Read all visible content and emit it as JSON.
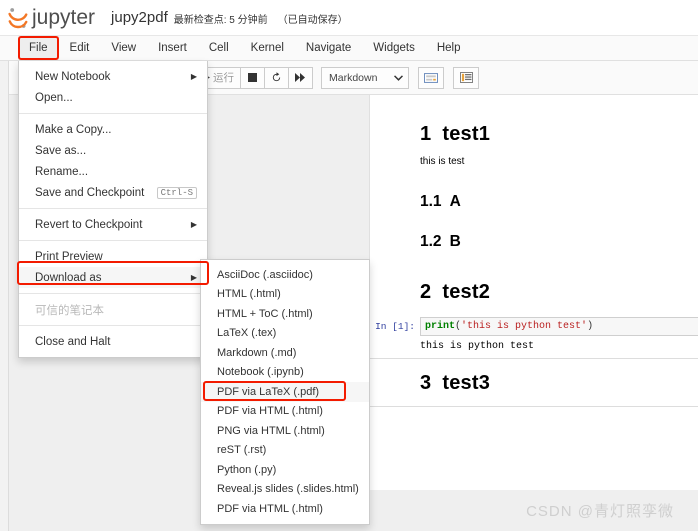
{
  "header": {
    "logo_text": "jupyter",
    "notebook_name": "jupy2pdf",
    "checkpoint_text": "最新检查点: 5 分钟前",
    "autosave_text": "（已自动保存）"
  },
  "menubar": {
    "items": [
      {
        "label": "File",
        "open": true
      },
      {
        "label": "Edit",
        "open": false
      },
      {
        "label": "View",
        "open": false
      },
      {
        "label": "Insert",
        "open": false
      },
      {
        "label": "Cell",
        "open": false
      },
      {
        "label": "Kernel",
        "open": false
      },
      {
        "label": "Navigate",
        "open": false
      },
      {
        "label": "Widgets",
        "open": false
      },
      {
        "label": "Help",
        "open": false
      }
    ]
  },
  "toolbar": {
    "run_label": "运行",
    "cell_type": "Markdown",
    "icons": {
      "run": "play-icon",
      "stop": "stop-icon",
      "restart": "restart-icon",
      "restart_run_all": "fast-forward-icon",
      "dropdown_caret": "chevron-down-icon",
      "command_palette": "keyboard-icon",
      "cell_toolbar": "list-icon"
    }
  },
  "file_menu": {
    "groups": [
      [
        {
          "label": "New Notebook",
          "submenu": true,
          "disabled": false,
          "highlighted": false
        },
        {
          "label": "Open...",
          "submenu": false,
          "disabled": false,
          "highlighted": false
        }
      ],
      [
        {
          "label": "Make a Copy...",
          "submenu": false,
          "disabled": false,
          "highlighted": false
        },
        {
          "label": "Save as...",
          "submenu": false,
          "disabled": false,
          "highlighted": false
        },
        {
          "label": "Rename...",
          "submenu": false,
          "disabled": false,
          "highlighted": false
        },
        {
          "label": "Save and Checkpoint",
          "shortcut": "Ctrl-S",
          "submenu": false,
          "disabled": false,
          "highlighted": false
        }
      ],
      [
        {
          "label": "Revert to Checkpoint",
          "submenu": true,
          "disabled": false,
          "highlighted": false
        }
      ],
      [
        {
          "label": "Print Preview",
          "submenu": false,
          "disabled": false,
          "highlighted": false
        },
        {
          "label": "Download as",
          "submenu": true,
          "disabled": false,
          "highlighted": true
        }
      ],
      [
        {
          "label": "可信的笔记本",
          "submenu": false,
          "disabled": true,
          "highlighted": false
        }
      ],
      [
        {
          "label": "Close and Halt",
          "submenu": false,
          "disabled": false,
          "highlighted": false
        }
      ]
    ]
  },
  "download_submenu": {
    "items": [
      {
        "label": "AsciiDoc (.asciidoc)",
        "highlighted": false
      },
      {
        "label": "HTML (.html)",
        "highlighted": false
      },
      {
        "label": "HTML + ToC (.html)",
        "highlighted": false
      },
      {
        "label": "LaTeX (.tex)",
        "highlighted": false
      },
      {
        "label": "Markdown (.md)",
        "highlighted": false
      },
      {
        "label": "Notebook (.ipynb)",
        "highlighted": false
      },
      {
        "label": "PDF via LaTeX (.pdf)",
        "highlighted": true
      },
      {
        "label": "PDF via HTML (.html)",
        "highlighted": false
      },
      {
        "label": "PNG via HTML (.html)",
        "highlighted": false
      },
      {
        "label": "reST (.rst)",
        "highlighted": false
      },
      {
        "label": "Python (.py)",
        "highlighted": false
      },
      {
        "label": "Reveal.js slides (.slides.html)",
        "highlighted": false
      },
      {
        "label": "PDF via HTML (.html)",
        "highlighted": false
      }
    ]
  },
  "notebook": {
    "cells": [
      {
        "type": "markdown",
        "heading_level": 1,
        "number": "1",
        "title": "test1"
      },
      {
        "type": "markdown",
        "paragraph": "this is test"
      },
      {
        "type": "markdown",
        "heading_level": 2,
        "number": "1.1",
        "title": "A"
      },
      {
        "type": "markdown",
        "heading_level": 2,
        "number": "1.2",
        "title": "B"
      },
      {
        "type": "markdown",
        "heading_level": 1,
        "number": "2",
        "title": "test2"
      },
      {
        "type": "code",
        "prompt": "In [1]:",
        "code_fn": "print",
        "code_open": "(",
        "code_str": "'this is python test'",
        "code_close": ")",
        "output": "this is python test"
      },
      {
        "type": "markdown",
        "heading_level": 1,
        "number": "3",
        "title": "test3"
      }
    ]
  },
  "annotations": {
    "color": "#f31b00",
    "boxes": [
      {
        "name": "file-menu-highlight"
      },
      {
        "name": "download-as-highlight"
      },
      {
        "name": "pdf-via-latex-highlight"
      }
    ]
  },
  "watermark": {
    "text": "CSDN @青灯照孪微"
  }
}
